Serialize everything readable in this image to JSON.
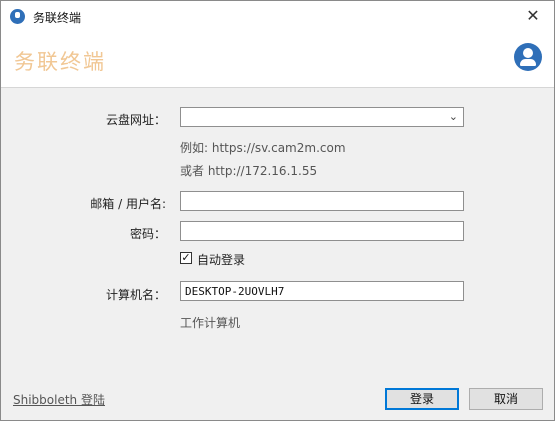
{
  "window": {
    "title": "务联终端",
    "close_glyph": "✕"
  },
  "banner": {
    "brand": "务联终端",
    "avatar_icon": "user-icon"
  },
  "form": {
    "cloud_url": {
      "label": "云盘网址：",
      "value": "",
      "hint1": "例如: https://sv.cam2m.com",
      "hint2": "或者 http://172.16.1.55"
    },
    "username": {
      "label": "邮箱 / 用户名:",
      "value": ""
    },
    "password": {
      "label": "密码：",
      "value": ""
    },
    "auto_login": {
      "label": "自动登录",
      "checked": true,
      "check_glyph": "✓"
    },
    "computer_name": {
      "label": "计算机名：",
      "value": "DESKTOP-2UOVLH7",
      "hint": "工作计算机"
    }
  },
  "footer": {
    "shibboleth_link": "Shibboleth 登陆",
    "login_button": "登录",
    "cancel_button": "取消"
  }
}
